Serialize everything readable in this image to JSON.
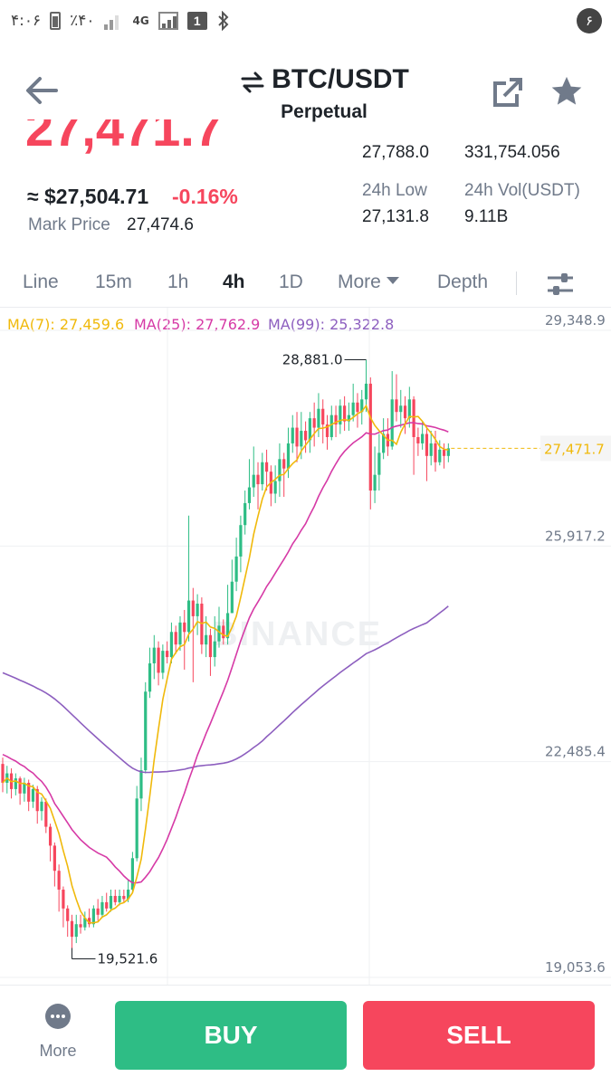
{
  "status_bar": {
    "time": "۴:۰۶",
    "battery": "٪۴۰",
    "network": "4G",
    "sim": "1",
    "right_badge": "۶"
  },
  "header": {
    "pair": "BTC/USDT",
    "contract_type": "Perpetual"
  },
  "price": {
    "last": "27,471.7",
    "usd": "≈ $27,504.71",
    "change": "-0.16%",
    "mark_label": "Mark Price",
    "mark_value": "27,474.6"
  },
  "stats": {
    "high_value": "27,788.0",
    "vol_btc_value": "331,754.056",
    "low_label": "24h Low",
    "low_value": "27,131.8",
    "vol_usdt_label": "24h Vol(USDT)",
    "vol_usdt_value": "9.11B"
  },
  "tabs": [
    {
      "label": "Line",
      "active": false
    },
    {
      "label": "15m",
      "active": false
    },
    {
      "label": "1h",
      "active": false
    },
    {
      "label": "4h",
      "active": true
    },
    {
      "label": "1D",
      "active": false
    },
    {
      "label": "More",
      "active": false
    },
    {
      "label": "Depth",
      "active": false
    }
  ],
  "ma_legend": [
    {
      "label": "MA(7): 27,459.6",
      "color": "#f0b90b"
    },
    {
      "label": "MA(25): 27,762.9",
      "color": "#d63aa6"
    },
    {
      "label": "MA(99): 25,322.8",
      "color": "#8d5fbf"
    }
  ],
  "colors": {
    "up": "#2ebd85",
    "down": "#f6465d",
    "ma7": "#f0b90b",
    "ma25": "#d63aa6",
    "ma99": "#8d5fbf",
    "grid": "#eff1f3",
    "axis_text": "#707a8a"
  },
  "watermark": "BINANCE",
  "chart_data": {
    "type": "candlestick",
    "y_ticks": [
      29348.9,
      25917.2,
      22485.4,
      19053.6
    ],
    "y_tick_labels": [
      "29,348.9",
      "25,917.2",
      "22,485.4",
      "19,053.6"
    ],
    "ylim": [
      19053.6,
      29348.9
    ],
    "current_price": 27471.7,
    "current_price_label": "27,471.7",
    "high_marker": {
      "index": 84,
      "value": 28881.0,
      "label": "28,881.0"
    },
    "low_marker": {
      "index": 16,
      "value": 19521.6,
      "label": "19,521.6"
    },
    "candles": [
      [
        22450,
        22150,
        22550,
        22000
      ],
      [
        22150,
        22300,
        22420,
        21980
      ],
      [
        22300,
        22050,
        22380,
        21900
      ],
      [
        22050,
        22220,
        22300,
        21950
      ],
      [
        22220,
        21980,
        22250,
        21800
      ],
      [
        21980,
        22150,
        22230,
        21850
      ],
      [
        22150,
        21850,
        22200,
        21700
      ],
      [
        21850,
        22050,
        22120,
        21750
      ],
      [
        22050,
        21700,
        22100,
        21500
      ],
      [
        21700,
        21850,
        21920,
        21550
      ],
      [
        21850,
        21450,
        21900,
        21350
      ],
      [
        21450,
        21150,
        21500,
        20900
      ],
      [
        21150,
        20750,
        21200,
        20500
      ],
      [
        20750,
        20450,
        20850,
        20100
      ],
      [
        20450,
        20150,
        20500,
        19850
      ],
      [
        20150,
        19950,
        20200,
        19700
      ],
      [
        19950,
        19700,
        20050,
        19521.6
      ],
      [
        19700,
        19900,
        20050,
        19600
      ],
      [
        19900,
        19850,
        20050,
        19750
      ],
      [
        19850,
        20000,
        20100,
        19800
      ],
      [
        20000,
        19900,
        20150,
        19850
      ],
      [
        19900,
        20150,
        20200,
        19850
      ],
      [
        20150,
        20050,
        20300,
        19950
      ],
      [
        20050,
        20250,
        20350,
        20000
      ],
      [
        20250,
        20150,
        20400,
        20100
      ],
      [
        20150,
        20350,
        20450,
        20100
      ],
      [
        20350,
        20250,
        20450,
        20200
      ],
      [
        20250,
        20350,
        20450,
        20200
      ],
      [
        20350,
        20300,
        20450,
        20250
      ],
      [
        20300,
        20450,
        20600,
        20250
      ],
      [
        20450,
        20950,
        21050,
        20400
      ],
      [
        20950,
        21900,
        22100,
        20900
      ],
      [
        21900,
        22350,
        22550,
        21700
      ],
      [
        22350,
        23600,
        23750,
        22300
      ],
      [
        23600,
        24050,
        24300,
        23500
      ],
      [
        24050,
        24300,
        24500,
        23800
      ],
      [
        24300,
        23900,
        24400,
        23700
      ],
      [
        23900,
        24250,
        24350,
        23800
      ],
      [
        24250,
        24150,
        24400,
        24050
      ],
      [
        24150,
        24550,
        24700,
        24050
      ],
      [
        24550,
        24350,
        24650,
        24200
      ],
      [
        24350,
        24700,
        24800,
        24250
      ],
      [
        24700,
        24550,
        24900,
        23950
      ],
      [
        24550,
        25050,
        26400,
        24400
      ],
      [
        25050,
        24800,
        25250,
        23750
      ],
      [
        24800,
        25000,
        25150,
        24500
      ],
      [
        25000,
        24350,
        25100,
        24200
      ],
      [
        24350,
        24500,
        24800,
        24150
      ],
      [
        24500,
        24150,
        24600,
        23850
      ],
      [
        24150,
        24400,
        24800,
        24000
      ],
      [
        24400,
        24650,
        24950,
        24300
      ],
      [
        24650,
        24450,
        24750,
        24350
      ],
      [
        24450,
        24850,
        25300,
        24350
      ],
      [
        24850,
        25350,
        25700,
        24850
      ],
      [
        25350,
        25750,
        26050,
        25200
      ],
      [
        25750,
        26250,
        26400,
        25500
      ],
      [
        26250,
        26600,
        26800,
        26100
      ],
      [
        26600,
        26850,
        27300,
        26500
      ],
      [
        26850,
        27050,
        27500,
        26700
      ],
      [
        27050,
        26900,
        27250,
        26500
      ],
      [
        26900,
        27250,
        27400,
        26800
      ],
      [
        27250,
        27100,
        27450,
        26800
      ],
      [
        27100,
        26750,
        27200,
        26550
      ],
      [
        26750,
        26950,
        27200,
        26600
      ],
      [
        26950,
        27300,
        27550,
        26700
      ],
      [
        27300,
        27150,
        27400,
        26700
      ],
      [
        27150,
        27550,
        27800,
        27000
      ],
      [
        27550,
        27800,
        28000,
        27400
      ],
      [
        27800,
        27500,
        28050,
        27250
      ],
      [
        27500,
        27750,
        28050,
        27300
      ],
      [
        27750,
        27600,
        27900,
        27400
      ],
      [
        27600,
        27950,
        28050,
        27400
      ],
      [
        27950,
        27800,
        28200,
        27500
      ],
      [
        27800,
        28100,
        28350,
        27650
      ],
      [
        28100,
        27850,
        28250,
        27550
      ],
      [
        27850,
        27650,
        28000,
        27450
      ],
      [
        27650,
        28000,
        28150,
        27600
      ],
      [
        28000,
        27850,
        28150,
        27650
      ],
      [
        27850,
        28150,
        28250,
        27700
      ],
      [
        28150,
        27900,
        28300,
        27750
      ],
      [
        27900,
        28000,
        28200,
        27750
      ],
      [
        28000,
        28200,
        28500,
        27900
      ],
      [
        28200,
        28050,
        28350,
        27800
      ],
      [
        28050,
        28250,
        28400,
        27850
      ],
      [
        28250,
        28500,
        28881.0,
        28050
      ],
      [
        28500,
        26800,
        28600,
        26500
      ],
      [
        26800,
        27050,
        27500,
        26600
      ],
      [
        27050,
        27400,
        27700,
        26800
      ],
      [
        27400,
        27700,
        27950,
        27300
      ],
      [
        27700,
        27500,
        27950,
        27350
      ],
      [
        27500,
        28250,
        28700,
        27450
      ],
      [
        28250,
        28050,
        28650,
        27900
      ],
      [
        28050,
        28150,
        28400,
        27800
      ],
      [
        28150,
        27950,
        28300,
        27700
      ],
      [
        27950,
        28250,
        28450,
        27800
      ],
      [
        28250,
        27650,
        28300,
        27050
      ],
      [
        27650,
        27550,
        27800,
        27350
      ],
      [
        27550,
        27700,
        27900,
        27450
      ],
      [
        27700,
        27350,
        27800,
        26950
      ],
      [
        27350,
        27550,
        27750,
        27200
      ],
      [
        27550,
        27250,
        27750,
        27100
      ],
      [
        27250,
        27450,
        27600,
        27200
      ],
      [
        27450,
        27350,
        27550,
        27150
      ],
      [
        27350,
        27472,
        27550,
        27250
      ]
    ]
  },
  "bottom": {
    "more_label": "More",
    "buy_label": "BUY",
    "sell_label": "SELL"
  }
}
